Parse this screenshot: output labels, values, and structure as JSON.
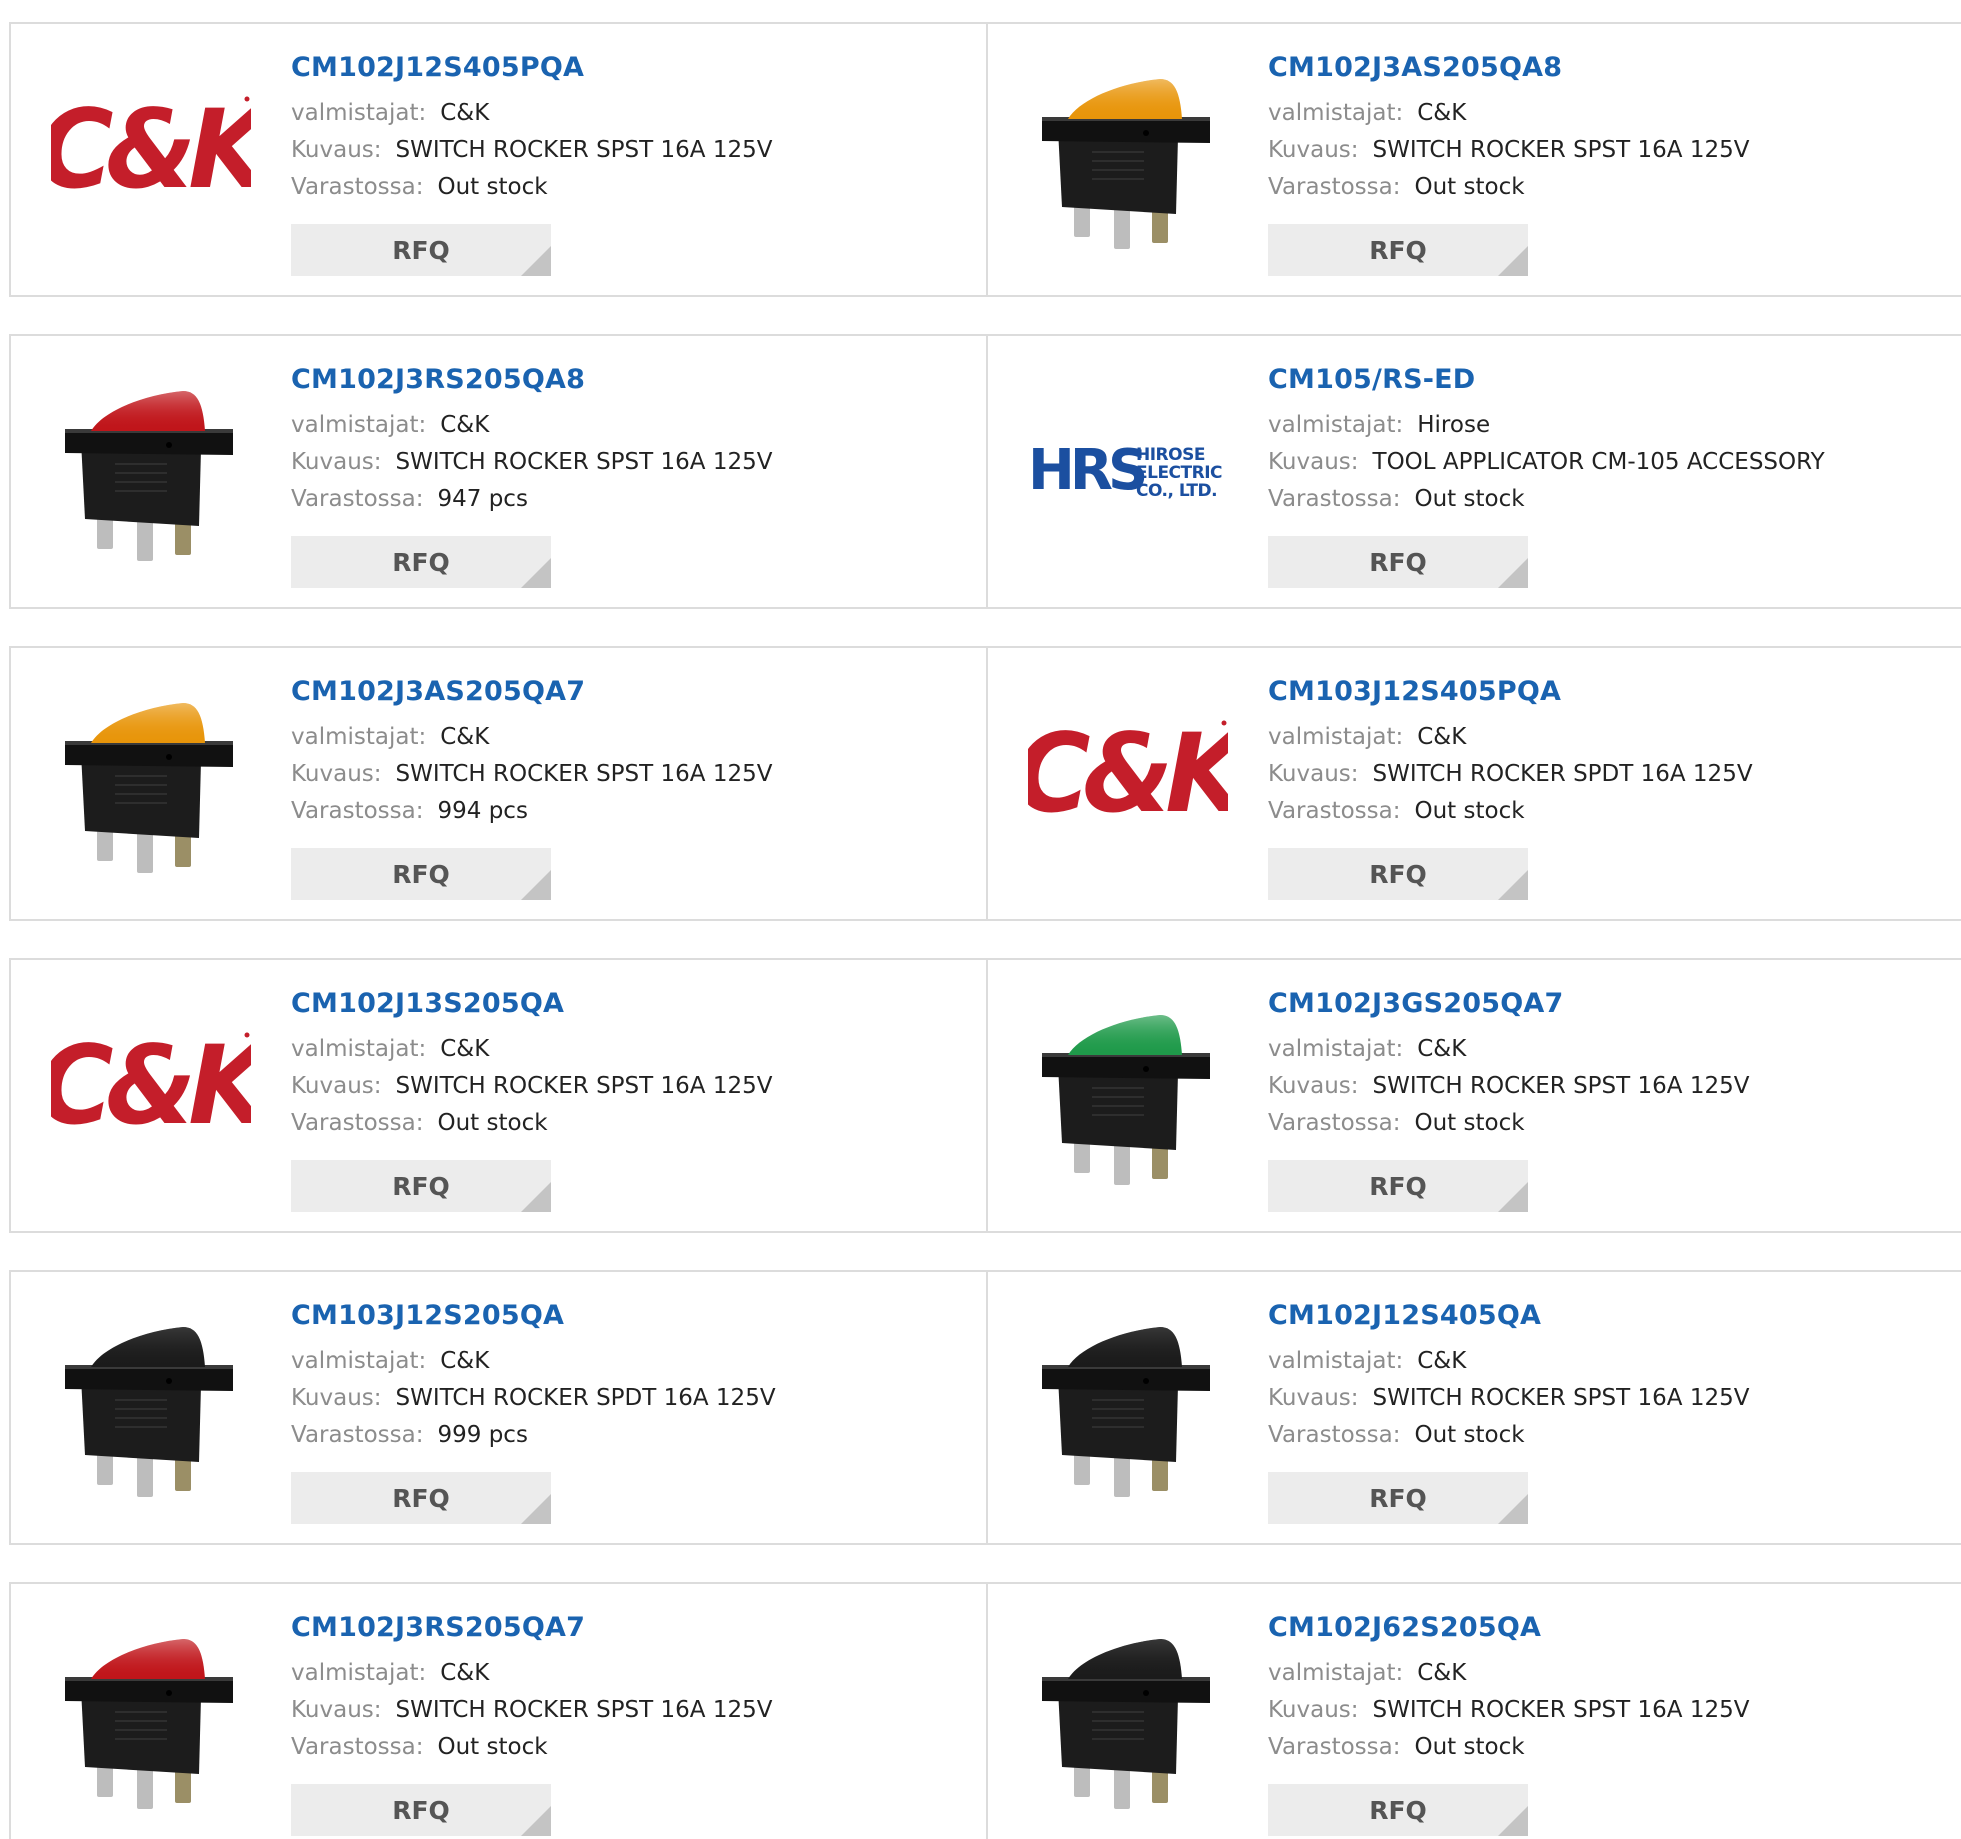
{
  "labels": {
    "manufacturer": "valmistajat:",
    "description": "Kuvaus:",
    "stock": "Varastossa:",
    "rfq": "RFQ"
  },
  "products": [
    {
      "part": "CM102J12S405PQA",
      "manufacturer": "C&K",
      "description": "SWITCH ROCKER SPST 16A 125V",
      "stock": "Out stock",
      "image": "ck-logo"
    },
    {
      "part": "CM102J3AS205QA8",
      "manufacturer": "C&K",
      "description": "SWITCH ROCKER SPST 16A 125V",
      "stock": "Out stock",
      "image": "rocker-switch",
      "rocker_color": "#e8950a",
      "lit": true
    },
    {
      "part": "CM102J3RS205QA8",
      "manufacturer": "C&K",
      "description": "SWITCH ROCKER SPST 16A 125V",
      "stock": "947 pcs",
      "image": "rocker-switch",
      "rocker_color": "#c0151a",
      "lit": true
    },
    {
      "part": "CM105/RS-ED",
      "manufacturer": "Hirose",
      "description": "TOOL APPLICATOR CM-105 ACCESSORY",
      "stock": "Out stock",
      "image": "hrs-logo",
      "logo_text": {
        "mark": "HRS",
        "line1": "HIROSE",
        "line2": "ELECTRIC",
        "line3": "CO., LTD."
      }
    },
    {
      "part": "CM102J3AS205QA7",
      "manufacturer": "C&K",
      "description": "SWITCH ROCKER SPST 16A 125V",
      "stock": "994 pcs",
      "image": "rocker-switch",
      "rocker_color": "#e8950a",
      "lit": true
    },
    {
      "part": "CM103J12S405PQA",
      "manufacturer": "C&K",
      "description": "SWITCH ROCKER SPDT 16A 125V",
      "stock": "Out stock",
      "image": "ck-logo"
    },
    {
      "part": "CM102J13S205QA",
      "manufacturer": "C&K",
      "description": "SWITCH ROCKER SPST 16A 125V",
      "stock": "Out stock",
      "image": "ck-logo"
    },
    {
      "part": "CM102J3GS205QA7",
      "manufacturer": "C&K",
      "description": "SWITCH ROCKER SPST 16A 125V",
      "stock": "Out stock",
      "image": "rocker-switch",
      "rocker_color": "#1f9a4a",
      "lit": true
    },
    {
      "part": "CM103J12S205QA",
      "manufacturer": "C&K",
      "description": "SWITCH ROCKER SPDT 16A 125V",
      "stock": "999 pcs",
      "image": "rocker-switch",
      "rocker_color": "#1b1b1b",
      "lit": false
    },
    {
      "part": "CM102J12S405QA",
      "manufacturer": "C&K",
      "description": "SWITCH ROCKER SPST 16A 125V",
      "stock": "Out stock",
      "image": "rocker-switch",
      "rocker_color": "#1b1b1b",
      "lit": false
    },
    {
      "part": "CM102J3RS205QA7",
      "manufacturer": "C&K",
      "description": "SWITCH ROCKER SPST 16A 125V",
      "stock": "Out stock",
      "image": "rocker-switch",
      "rocker_color": "#c0151a",
      "lit": true
    },
    {
      "part": "CM102J62S205QA",
      "manufacturer": "C&K",
      "description": "SWITCH ROCKER SPST 16A 125V",
      "stock": "Out stock",
      "image": "rocker-switch",
      "rocker_color": "#1b1b1b",
      "lit": false
    }
  ],
  "colors": {
    "part_link": "#1a63b0",
    "label": "#8c8c8c",
    "ck_logo_red": "#c41e2a",
    "hrs_logo_blue": "#1b4fa0",
    "rfq_bg": "#ececec"
  }
}
